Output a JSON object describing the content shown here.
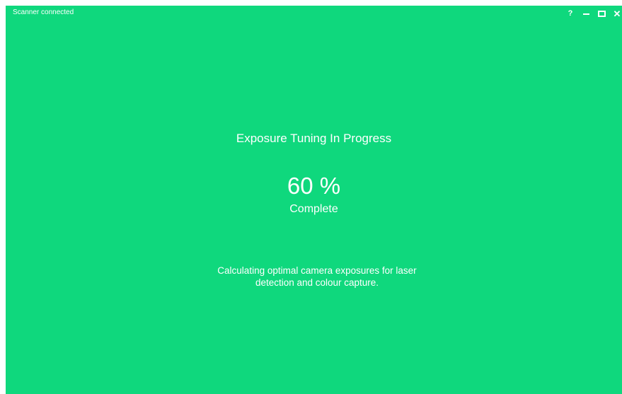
{
  "window": {
    "status": "Scanner connected",
    "controls": {
      "help": "?",
      "close": "✕"
    },
    "background_color": "#0fd87d",
    "text_color": "#ffffff"
  },
  "progress": {
    "title": "Exposure Tuning In Progress",
    "percent_label": "60 %",
    "percent_value": 60,
    "complete_label": "Complete",
    "description": "Calculating optimal camera exposures for laser detection and colour capture."
  }
}
